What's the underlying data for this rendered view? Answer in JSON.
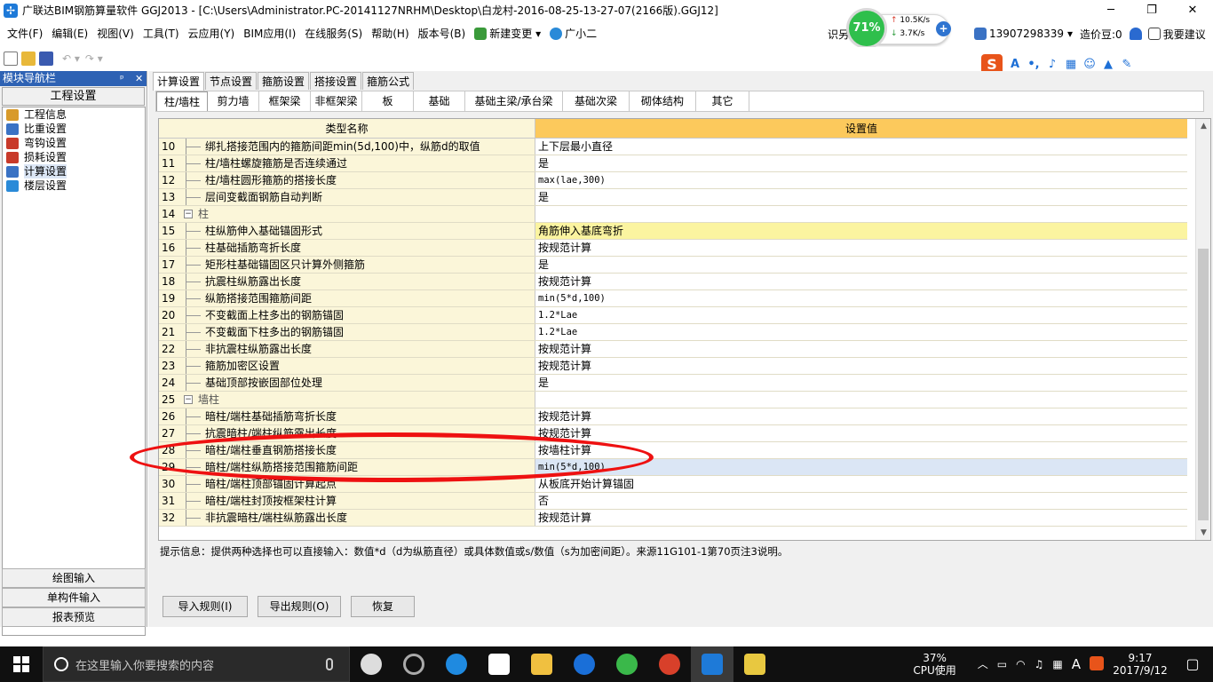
{
  "window": {
    "title": "广联达BIM钢筋算量软件 GGJ2013 - [C:\\Users\\Administrator.PC-20141127NRHM\\Desktop\\白龙村-2016-08-25-13-27-07(2166版).GGJ12]",
    "minimize": "─",
    "restore": "❐",
    "close": "✕"
  },
  "menu": {
    "items": [
      "文件(F)",
      "编辑(E)",
      "视图(V)",
      "工具(T)",
      "云应用(Y)",
      "BIM应用(I)",
      "在线服务(S)",
      "帮助(H)",
      "版本号(B)"
    ],
    "new_change": "新建变更",
    "assistant": "广小二",
    "account": "13907298339",
    "coins": "造价豆:0",
    "suggest": "我要建议",
    "partial_label": "识另"
  },
  "net": {
    "percent": "71%",
    "up": "10.5K/s",
    "down": "3.7K/s"
  },
  "nav": {
    "title": "模块导航栏",
    "pin": "ᵖ",
    "close": "✕",
    "header": "工程设置",
    "items": [
      "工程信息",
      "比重设置",
      "弯钩设置",
      "损耗设置",
      "计算设置",
      "楼层设置"
    ],
    "selected": "计算设置",
    "buttons": [
      "绘图输入",
      "单构件输入",
      "报表预览"
    ],
    "icon_colors": [
      "#d89a2a",
      "#3a72c4",
      "#c83a2a",
      "#c83a2a",
      "#3a72c4",
      "#2a8ad8"
    ]
  },
  "tabs1": [
    "计算设置",
    "节点设置",
    "箍筋设置",
    "搭接设置",
    "箍筋公式"
  ],
  "tabs1_active": "计算设置",
  "tabs2": [
    "柱/墙柱",
    "剪力墙",
    "框架梁",
    "非框架梁",
    "板",
    "基础",
    "基础主梁/承台梁",
    "基础次梁",
    "砌体结构",
    "其它"
  ],
  "tabs2_active": "柱/墙柱",
  "grid": {
    "col_name": "类型名称",
    "col_value": "设置值",
    "rows": [
      {
        "n": "10",
        "name": "绑扎搭接范围内的箍筋间距min(5d,100)中，纵筋d的取值",
        "val": "上下层最小直径"
      },
      {
        "n": "11",
        "name": "柱/墙柱螺旋箍筋是否连续通过",
        "val": "是"
      },
      {
        "n": "12",
        "name": "柱/墙柱圆形箍筋的搭接长度",
        "val": "max(lae,300)",
        "mono": true
      },
      {
        "n": "13",
        "name": "层间变截面钢筋自动判断",
        "val": "是"
      },
      {
        "n": "14",
        "name": "柱",
        "val": "",
        "group": true
      },
      {
        "n": "15",
        "name": "柱纵筋伸入基础锚固形式",
        "val": "角筋伸入基底弯折",
        "hl": true
      },
      {
        "n": "16",
        "name": "柱基础插筋弯折长度",
        "val": "按规范计算"
      },
      {
        "n": "17",
        "name": "矩形柱基础锚固区只计算外侧箍筋",
        "val": "是"
      },
      {
        "n": "18",
        "name": "抗震柱纵筋露出长度",
        "val": "按规范计算"
      },
      {
        "n": "19",
        "name": "纵筋搭接范围箍筋间距",
        "val": "min(5*d,100)",
        "mono": true
      },
      {
        "n": "20",
        "name": "不变截面上柱多出的钢筋锚固",
        "val": "1.2*Lae",
        "mono": true
      },
      {
        "n": "21",
        "name": "不变截面下柱多出的钢筋锚固",
        "val": "1.2*Lae",
        "mono": true
      },
      {
        "n": "22",
        "name": "非抗震柱纵筋露出长度",
        "val": "按规范计算"
      },
      {
        "n": "23",
        "name": "箍筋加密区设置",
        "val": "按规范计算"
      },
      {
        "n": "24",
        "name": "基础顶部按嵌固部位处理",
        "val": "是"
      },
      {
        "n": "25",
        "name": "墙柱",
        "val": "",
        "group": true
      },
      {
        "n": "26",
        "name": "暗柱/端柱基础插筋弯折长度",
        "val": "按规范计算"
      },
      {
        "n": "27",
        "name": "抗震暗柱/端柱纵筋露出长度",
        "val": "按规范计算"
      },
      {
        "n": "28",
        "name": "暗柱/端柱垂直钢筋搭接长度",
        "val": "按墙柱计算"
      },
      {
        "n": "29",
        "name": "暗柱/端柱纵筋搭接范围箍筋间距",
        "val": "min(5*d,100)",
        "mono": true,
        "sel": true
      },
      {
        "n": "30",
        "name": "暗柱/端柱顶部锚固计算起点",
        "val": "从板底开始计算锚固"
      },
      {
        "n": "31",
        "name": "暗柱/端柱封顶按框架柱计算",
        "val": "否"
      },
      {
        "n": "32",
        "name": "非抗震暗柱/端柱纵筋露出长度",
        "val": "按规范计算"
      }
    ]
  },
  "hint": "提示信息：提供两种选择也可以直接输入：数值*d（d为纵筋直径）或具体数值或s/数值（s为加密间距）。来源11G101-1第70页注3说明。",
  "buttons": {
    "import": "导入规则(I)",
    "export": "导出规则(O)",
    "restore": "恢复"
  },
  "taskbar": {
    "search_placeholder": "在这里输入你要搜索的内容",
    "cpu_percent": "37%",
    "cpu_label": "CPU使用",
    "ime": "A",
    "time": "9:17",
    "date": "2017/9/12"
  }
}
